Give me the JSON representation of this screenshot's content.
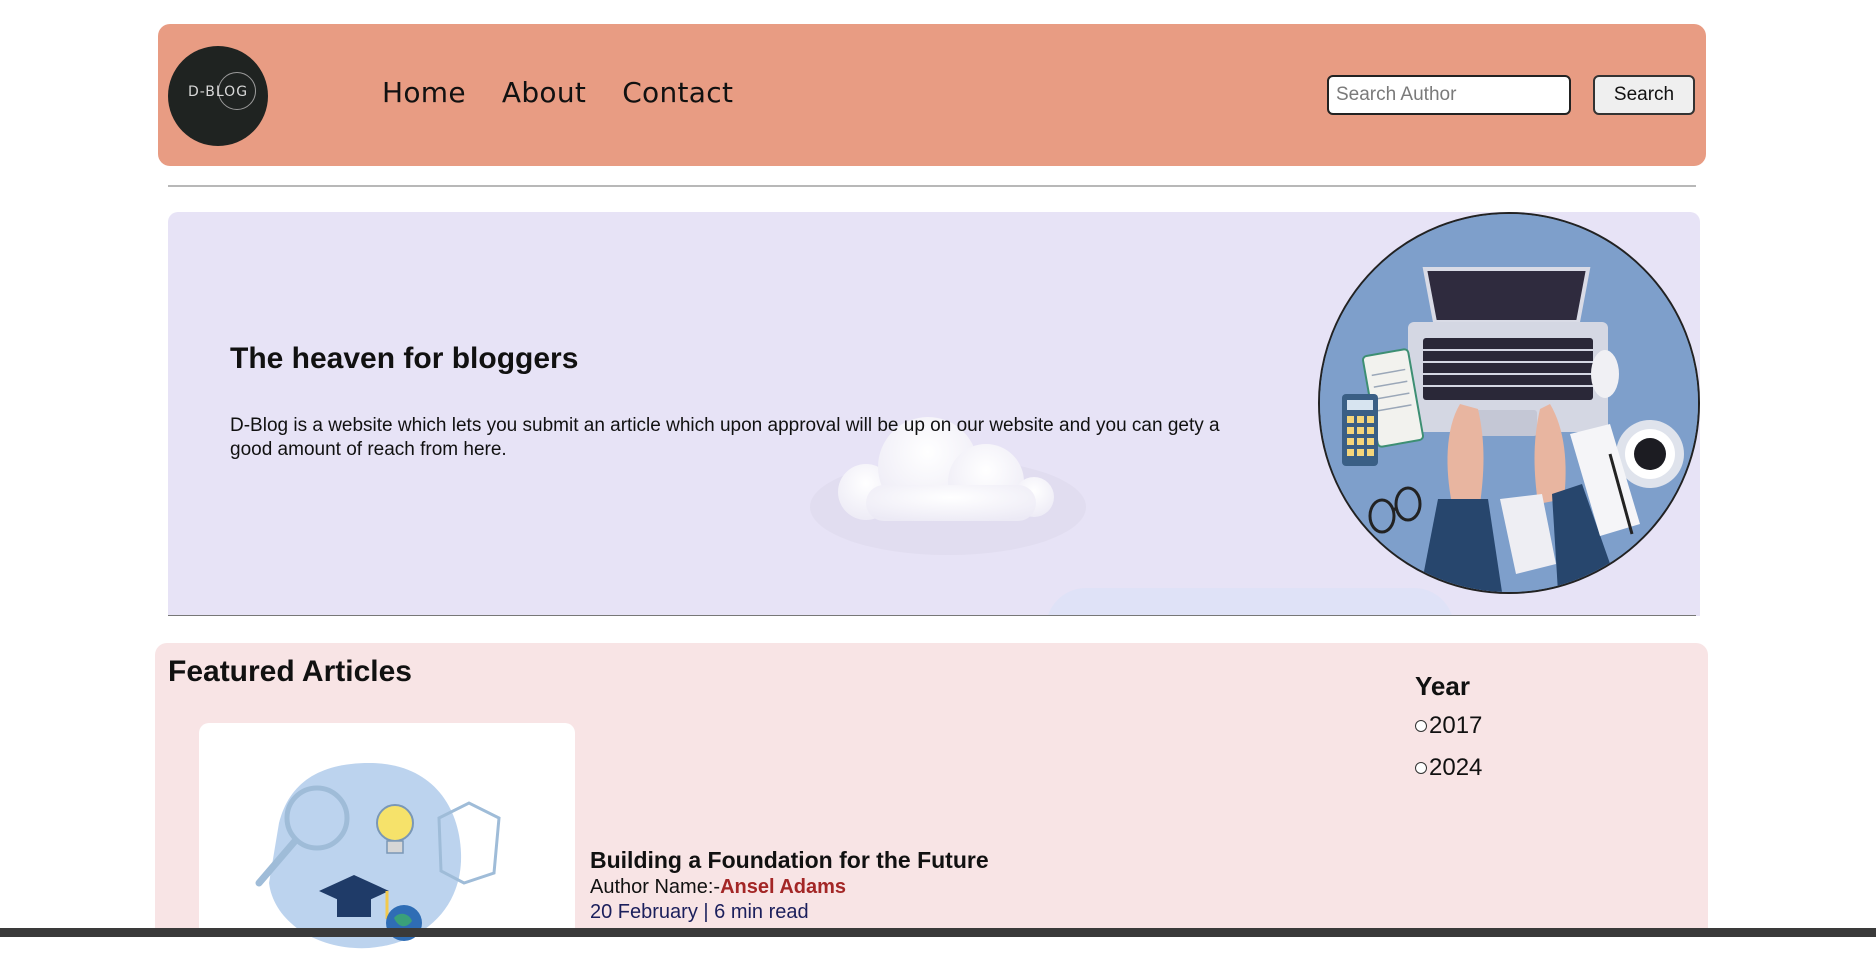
{
  "header": {
    "logo_text": "D-BLOG",
    "nav": [
      "Home",
      "About",
      "Contact"
    ],
    "search_placeholder": "Search Author",
    "search_button": "Search"
  },
  "hero": {
    "title": "The heaven for bloggers",
    "text": "D-Blog is a website which lets you submit an article which upon approval will be up on our website and you can gety a good amount of reach from here."
  },
  "featured": {
    "title": "Featured Articles",
    "article": {
      "title": "Building a Foundation for the Future",
      "author_prefix": "Author Name:-",
      "author_name": "Ansel Adams",
      "meta": "20 February | 6 min read"
    },
    "filter": {
      "title": "Year",
      "options": [
        "2017",
        "2024"
      ]
    }
  },
  "colors": {
    "navbar": "#e89c83",
    "hero_bg": "#e7e3f6",
    "featured_bg": "#f8e4e5",
    "author_name": "#a32626",
    "meta": "#1b1f5c"
  }
}
